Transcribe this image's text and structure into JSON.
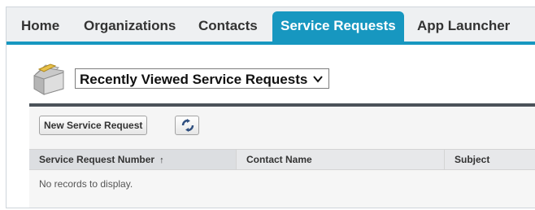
{
  "tabs": [
    {
      "label": "Home",
      "active": false
    },
    {
      "label": "Organizations",
      "active": false
    },
    {
      "label": "Contacts",
      "active": false
    },
    {
      "label": "Service Requests",
      "active": true
    },
    {
      "label": "App Launcher",
      "active": false
    }
  ],
  "view": {
    "selected": "Recently Viewed Service Requests",
    "icon": "folder-icon"
  },
  "toolbar": {
    "new_label": "New Service Request",
    "refresh_icon": "refresh-icon"
  },
  "table": {
    "columns": [
      "Service Request Number",
      "Contact Name",
      "Subject"
    ],
    "sort_indicator": "↑",
    "empty_message": "No records to display."
  },
  "colors": {
    "accent": "#1797c0",
    "panel_border": "#4b5259"
  }
}
